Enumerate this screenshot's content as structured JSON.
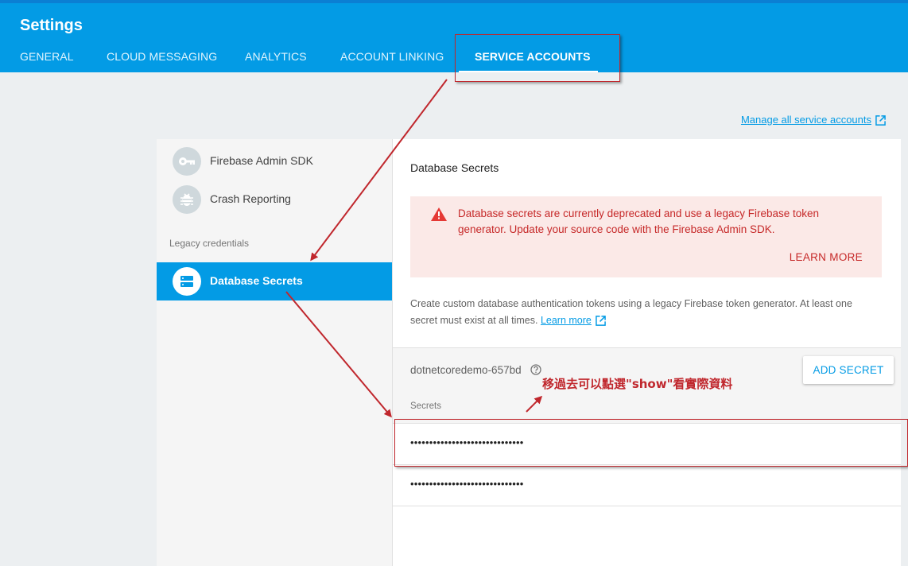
{
  "header": {
    "title": "Settings",
    "tabs": [
      {
        "label": "GENERAL"
      },
      {
        "label": "CLOUD MESSAGING"
      },
      {
        "label": "ANALYTICS"
      },
      {
        "label": "ACCOUNT LINKING"
      },
      {
        "label": "SERVICE ACCOUNTS"
      }
    ],
    "active_tab": "SERVICE ACCOUNTS"
  },
  "manage_link": "Manage all service accounts",
  "sidebar": {
    "items": [
      {
        "label": "Firebase Admin SDK",
        "icon": "key-icon"
      },
      {
        "label": "Crash Reporting",
        "icon": "bug-icon"
      }
    ],
    "legacy_label": "Legacy credentials",
    "legacy_items": [
      {
        "label": "Database Secrets",
        "icon": "storage-icon",
        "selected": true
      }
    ]
  },
  "main": {
    "title": "Database Secrets",
    "warning": {
      "text": "Database secrets are currently deprecated and use a legacy Firebase token generator. Update your source code with the Firebase Admin SDK.",
      "button": "LEARN MORE"
    },
    "description": "Create custom database authentication tokens using a legacy Firebase token generator. At least one secret must exist at all times.",
    "description_link": "Learn more",
    "database_name": "dotnetcoredemo-657bd",
    "add_button": "ADD SECRET",
    "secrets_header": "Secrets",
    "secrets": [
      "••••••••••••••••••••••••••••••",
      "••••••••••••••••••••••••••••••"
    ]
  },
  "annotation": "移過去可以點選\"show\"看實際資料",
  "colors": {
    "header_blue": "#039be5",
    "warning_red": "#c62828",
    "warning_bg": "#fbe9e7",
    "annotation_red": "#c0272d"
  }
}
